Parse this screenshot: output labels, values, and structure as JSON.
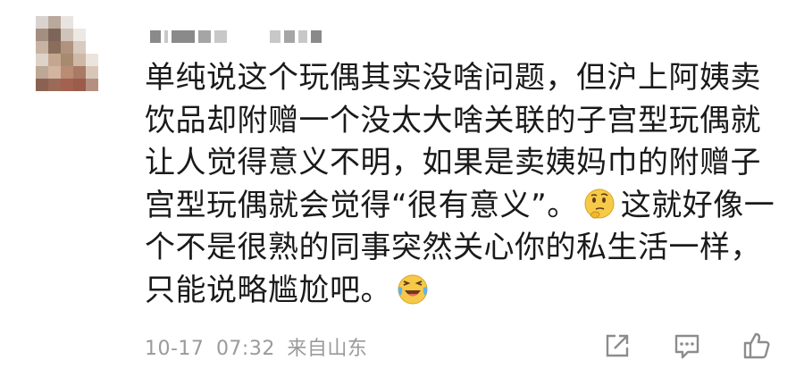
{
  "comment": {
    "lines": [
      "单纯说这个玩偶其实没啥问题，但沪上阿姨卖",
      "饮品却附赠一个没太大啥关联的子宫型玩偶就",
      "让人觉得意义不明，如果是卖姨妈巾的附赠子",
      "宫型玩偶就会觉得“很有意义”。",
      "这就好像一",
      "个不是很熟的同事突然关心你的私生活一样，",
      "只能说略尴尬吧。"
    ],
    "emojis": [
      "thinking-face-icon",
      "laughing-crying-face-icon"
    ]
  },
  "meta": {
    "date": "10-17",
    "time": "07:32",
    "location": "来自山东"
  },
  "actions": [
    "share-icon",
    "comment-icon",
    "like-icon"
  ],
  "colors": {
    "text": "#1a1a1a",
    "meta": "#9a9a9a",
    "icon": "#8c8c8c",
    "emoji_yellow": "#f7c948"
  }
}
